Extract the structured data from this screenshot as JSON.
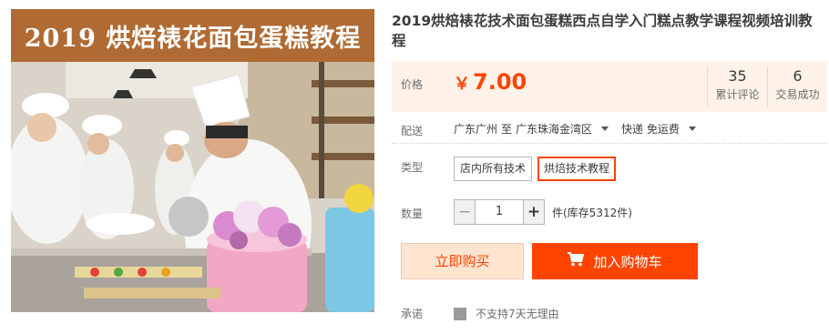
{
  "banner": {
    "text": "2019 烘焙裱花面包蛋糕教程"
  },
  "product": {
    "title": "2019烘焙裱花技术面包蛋糕西点自学入门糕点教学课程视频培训教程"
  },
  "price": {
    "label": "价格",
    "currency": "￥",
    "value": "7.00",
    "accent_color": "#ff4400"
  },
  "stats": [
    {
      "count": "35",
      "label": "累计评论"
    },
    {
      "count": "6",
      "label": "交易成功"
    }
  ],
  "shipping": {
    "label": "配送",
    "from": "广东广州",
    "to_word": "至",
    "destination": "广东珠海金湾区",
    "method": "快递 免运费"
  },
  "type": {
    "label": "类型",
    "options": [
      {
        "label": "店内所有技术",
        "selected": false
      },
      {
        "label": "烘焙技术教程",
        "selected": true
      }
    ]
  },
  "quantity": {
    "label": "数量",
    "value": "1",
    "minus": "−",
    "plus": "+",
    "stock_text": "件(库存5312件)"
  },
  "actions": {
    "buy_now": "立即购买",
    "add_to_cart": "加入购物车",
    "cart_icon": "cart-icon"
  },
  "promise": {
    "label": "承诺",
    "text": "不支持7天无理由"
  }
}
